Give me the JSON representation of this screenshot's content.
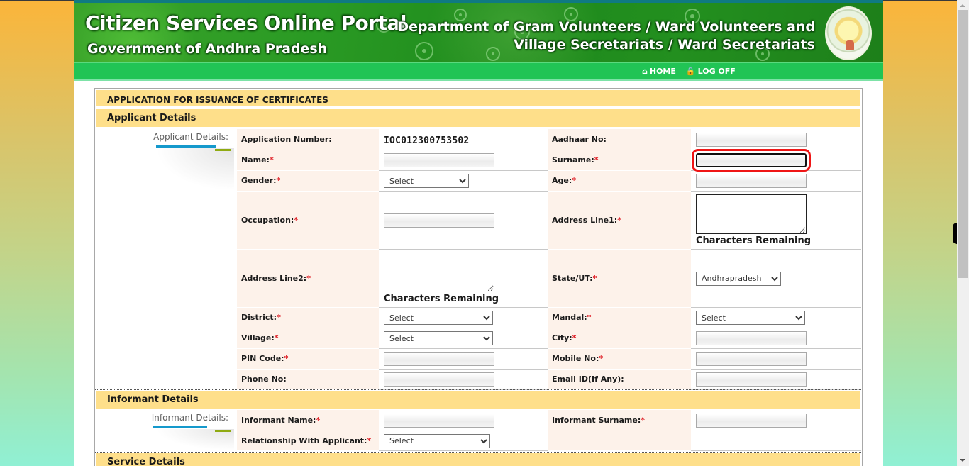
{
  "header": {
    "title": "Citizen Services Online Portal",
    "subtitle": "Government of Andhra Pradesh",
    "department_line1": "Department of Gram Volunteers / Ward Volunteers and",
    "department_line2": "Village Secretariats / Ward Secretariats",
    "emblem_icon": "ap-state-emblem"
  },
  "nav": {
    "home": {
      "label": "HOME",
      "icon": "home-icon"
    },
    "logoff": {
      "label": "LOG OFF",
      "icon": "lock-icon"
    }
  },
  "form": {
    "title": "APPLICATION FOR ISSUANCE OF CERTIFICATES",
    "applicant": {
      "section_title": "Applicant Details",
      "side_label": "Applicant Details:",
      "application_number_label": "Application Number:",
      "application_number": "IOC012300753502",
      "aadhaar_label": "Aadhaar No:",
      "aadhaar_value": "",
      "name_label": "Name:",
      "name_value": "",
      "surname_label": "Surname:",
      "surname_value": "",
      "gender_label": "Gender:",
      "gender_selected": "Select",
      "age_label": "Age:",
      "age_value": "",
      "occupation_label": "Occupation:",
      "occupation_value": "",
      "address1_label": "Address Line1:",
      "address1_value": "",
      "address1_counter": "Characters Remaining",
      "address2_label": "Address Line2:",
      "address2_value": "",
      "address2_counter": "Characters Remaining",
      "state_label": "State/UT:",
      "state_selected": "Andhrapradesh",
      "district_label": "District:",
      "district_selected": "Select",
      "mandal_label": "Mandal:",
      "mandal_selected": "Select",
      "village_label": "Village:",
      "village_selected": "Select",
      "city_label": "City:",
      "city_value": "",
      "pin_label": "PIN Code:",
      "pin_value": "",
      "mobile_label": "Mobile No:",
      "mobile_value": "",
      "phone_label": "Phone No:",
      "phone_value": "",
      "email_label": "Email ID(If Any):",
      "email_value": "",
      "required_mark": "*"
    },
    "informant": {
      "section_title": "Informant Details",
      "side_label": "Informant Details:",
      "name_label": "Informant Name:",
      "name_value": "",
      "surname_label": "Informant Surname:",
      "surname_value": "",
      "relationship_label": "Relationship With Applicant:",
      "relationship_selected": "Select"
    },
    "service": {
      "section_title": "Service Details"
    }
  },
  "focus": {
    "highlighted_field": "surname-input"
  }
}
